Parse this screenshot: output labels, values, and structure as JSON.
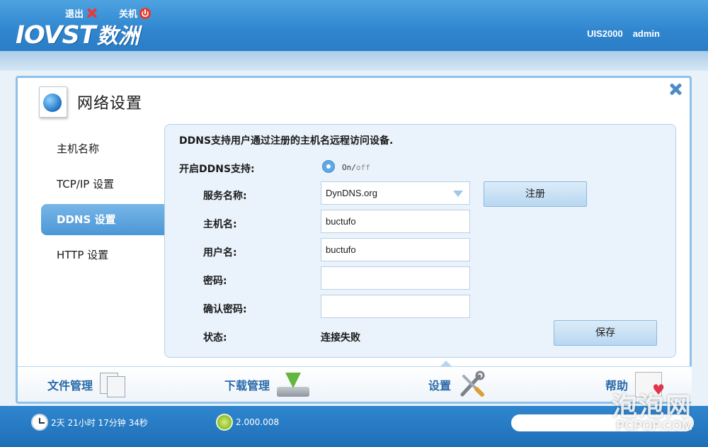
{
  "header": {
    "logout_label": "退出",
    "shutdown_label": "关机",
    "logo_en": "IOVST",
    "logo_cn": "数洲",
    "device_model": "UIS2000",
    "username": "admin"
  },
  "page": {
    "title": "网络设置",
    "close_icon": "close-icon"
  },
  "sidebar": {
    "items": [
      {
        "label": "主机名称",
        "active": false
      },
      {
        "label": "TCP/IP 设置",
        "active": false
      },
      {
        "label": "DDNS 设置",
        "active": true
      },
      {
        "label": "HTTP 设置",
        "active": false
      }
    ]
  },
  "ddns": {
    "description": "DDNS支持用户通过注册的主机名远程访问设备.",
    "enable_label": "开启DDNS支持:",
    "toggle_on": "On",
    "toggle_sep": "/",
    "toggle_off": "off",
    "service_label": "服务名称:",
    "service_value": "DynDNS.org",
    "register_button": "注册",
    "hostname_label": "主机名:",
    "hostname_value": "buctufo",
    "username_label": "用户名:",
    "username_value": "buctufo",
    "password_label": "密码:",
    "password_value": "",
    "confirm_label": "确认密码:",
    "confirm_value": "",
    "status_label": "状态:",
    "status_value": "连接失败",
    "save_button": "保存"
  },
  "tabs": [
    {
      "label": "文件管理",
      "icon": "files-icon"
    },
    {
      "label": "下载管理",
      "icon": "download-icon"
    },
    {
      "label": "设置",
      "icon": "tools-icon",
      "active": true
    },
    {
      "label": "帮助",
      "icon": "help-icon"
    }
  ],
  "footer": {
    "uptime": "2天 21小时 17分钟 34秒",
    "version": "2.000.008"
  },
  "watermark": {
    "cn": "泡泡网",
    "en": "PCPOP.COM"
  },
  "colors": {
    "header_blue": "#2f86cf",
    "accent": "#4c97d6",
    "tab_text": "#2869a8"
  }
}
